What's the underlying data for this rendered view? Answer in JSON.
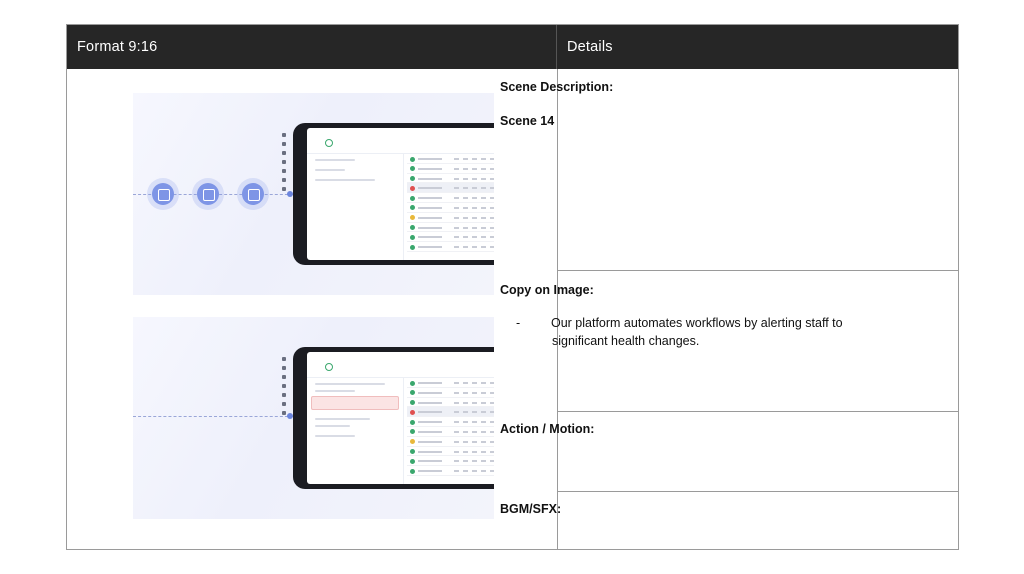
{
  "header": {
    "left_title": "Format 9:16",
    "right_title": "Details"
  },
  "scene_description": {
    "label": "Scene Description:",
    "value": "Scene 14"
  },
  "copy_on_image": {
    "label": "Copy on Image:",
    "bullet": "-",
    "line1": "Our platform automates workflows by alerting staff to",
    "line2": "significant health changes."
  },
  "action_motion": {
    "label": "Action / Motion:"
  },
  "bgm_sfx": {
    "label": "BGM/SFX:"
  },
  "colors": {
    "header_bg": "#262626",
    "node_blue": "#7e95e6",
    "status_green": "#3aa76d",
    "status_red": "#e05050",
    "status_yellow": "#e8b83a"
  }
}
